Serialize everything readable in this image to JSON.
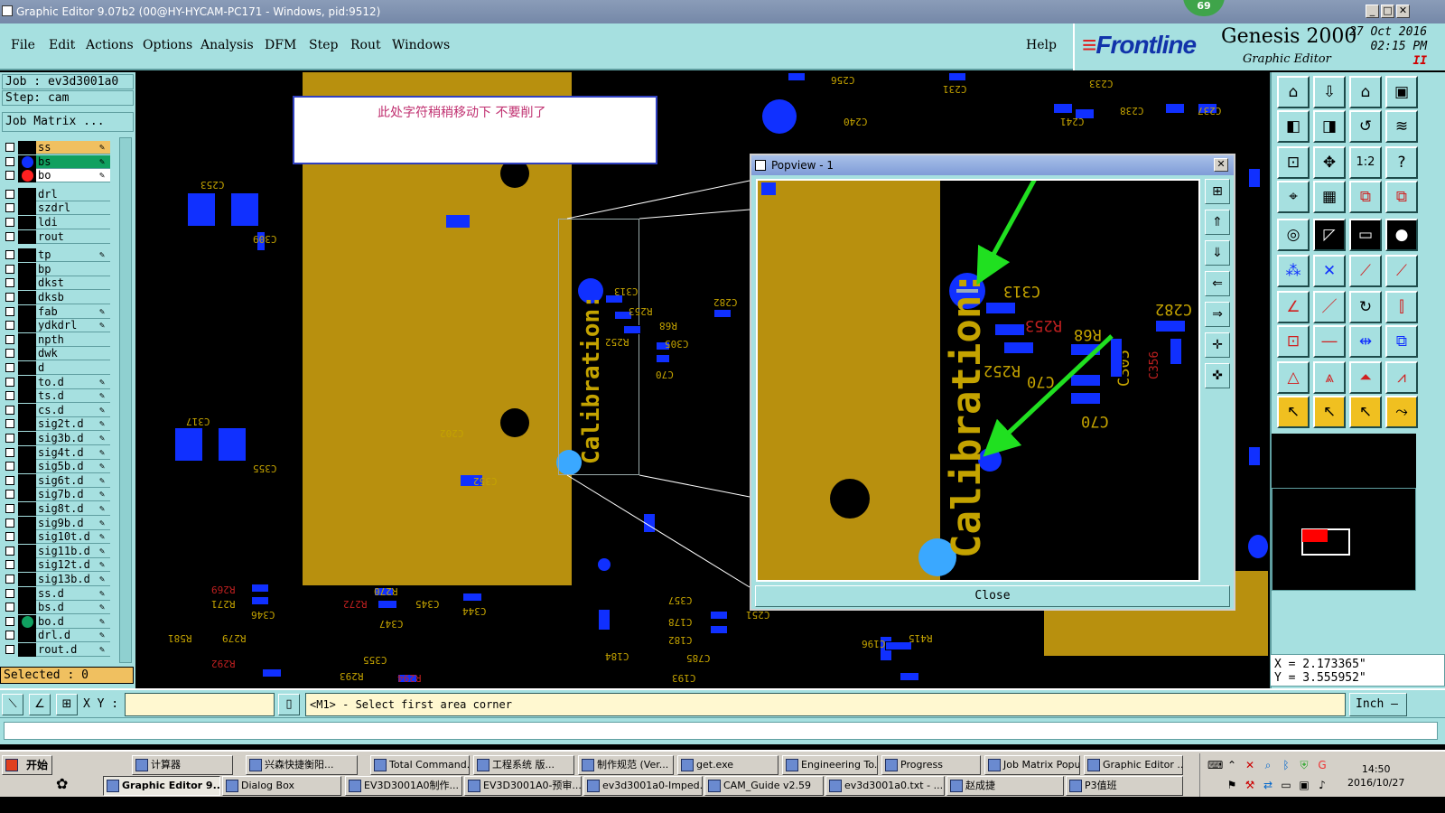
{
  "window": {
    "title": "Graphic Editor 9.07b2 (00@HY-HYCAM-PC171 - Windows, pid:9512)",
    "badge": "69"
  },
  "menu": [
    "File",
    "Edit",
    "Actions",
    "Options",
    "Analysis",
    "DFM",
    "Step",
    "Rout",
    "Windows"
  ],
  "help_label": "Help",
  "brand": {
    "logo": "Frontline",
    "product": "Genesis 2000",
    "subtitle": "Graphic Editor",
    "date": "27 Oct 2016",
    "time": "02:15 PM",
    "indicator": "II"
  },
  "left": {
    "job": "Job : ev3d3001a0",
    "step": "Step: cam",
    "job_matrix": "Job Matrix ...",
    "selected": "Selected : 0",
    "layers": [
      {
        "name": "ss",
        "color": "#f0c060",
        "dot": "",
        "mark": "✎"
      },
      {
        "name": "bs",
        "color": "#10a060",
        "dot": "#1030ff",
        "mark": "✎"
      },
      {
        "name": "bo",
        "color": "#ffffff",
        "dot": "#ff2020",
        "mark": "✎"
      },
      {
        "name": "drl",
        "color": "#a6e0e0",
        "dot": "",
        "mark": ""
      },
      {
        "name": "szdrl",
        "color": "#a6e0e0",
        "dot": "",
        "mark": ""
      },
      {
        "name": "ldi",
        "color": "#a6e0e0",
        "dot": "",
        "mark": ""
      },
      {
        "name": "rout",
        "color": "#a6e0e0",
        "dot": "",
        "mark": ""
      },
      {
        "name": "tp",
        "color": "#a6e0e0",
        "dot": "",
        "mark": "✎"
      },
      {
        "name": "bp",
        "color": "#a6e0e0",
        "dot": "",
        "mark": ""
      },
      {
        "name": "dkst",
        "color": "#a6e0e0",
        "dot": "",
        "mark": ""
      },
      {
        "name": "dksb",
        "color": "#a6e0e0",
        "dot": "",
        "mark": ""
      },
      {
        "name": "fab",
        "color": "#a6e0e0",
        "dot": "",
        "mark": "✎"
      },
      {
        "name": "ydkdrl",
        "color": "#a6e0e0",
        "dot": "",
        "mark": "✎"
      },
      {
        "name": "npth",
        "color": "#a6e0e0",
        "dot": "",
        "mark": ""
      },
      {
        "name": "dwk",
        "color": "#a6e0e0",
        "dot": "",
        "mark": ""
      },
      {
        "name": "d",
        "color": "#a6e0e0",
        "dot": "",
        "mark": ""
      },
      {
        "name": "to.d",
        "color": "#a6e0e0",
        "dot": "",
        "mark": "✎"
      },
      {
        "name": "ts.d",
        "color": "#a6e0e0",
        "dot": "",
        "mark": "✎"
      },
      {
        "name": "cs.d",
        "color": "#a6e0e0",
        "dot": "",
        "mark": "✎"
      },
      {
        "name": "sig2t.d",
        "color": "#a6e0e0",
        "dot": "",
        "mark": "✎"
      },
      {
        "name": "sig3b.d",
        "color": "#a6e0e0",
        "dot": "",
        "mark": "✎"
      },
      {
        "name": "sig4t.d",
        "color": "#a6e0e0",
        "dot": "",
        "mark": "✎"
      },
      {
        "name": "sig5b.d",
        "color": "#a6e0e0",
        "dot": "",
        "mark": "✎"
      },
      {
        "name": "sig6t.d",
        "color": "#a6e0e0",
        "dot": "",
        "mark": "✎"
      },
      {
        "name": "sig7b.d",
        "color": "#a6e0e0",
        "dot": "",
        "mark": "✎"
      },
      {
        "name": "sig8t.d",
        "color": "#a6e0e0",
        "dot": "",
        "mark": "✎"
      },
      {
        "name": "sig9b.d",
        "color": "#a6e0e0",
        "dot": "",
        "mark": "✎"
      },
      {
        "name": "sig10t.d",
        "color": "#a6e0e0",
        "dot": "",
        "mark": "✎"
      },
      {
        "name": "sig11b.d",
        "color": "#a6e0e0",
        "dot": "",
        "mark": "✎"
      },
      {
        "name": "sig12t.d",
        "color": "#a6e0e0",
        "dot": "",
        "mark": "✎"
      },
      {
        "name": "sig13b.d",
        "color": "#a6e0e0",
        "dot": "",
        "mark": "✎"
      },
      {
        "name": "ss.d",
        "color": "#a6e0e0",
        "dot": "",
        "mark": "✎"
      },
      {
        "name": "bs.d",
        "color": "#a6e0e0",
        "dot": "",
        "mark": "✎"
      },
      {
        "name": "bo.d",
        "color": "#a6e0e0",
        "dot": "#10a060",
        "mark": "✎"
      },
      {
        "name": "drl.d",
        "color": "#a6e0e0",
        "dot": "",
        "mark": "✎"
      },
      {
        "name": "rout.d",
        "color": "#a6e0e0",
        "dot": "",
        "mark": "✎"
      }
    ]
  },
  "canvas": {
    "note": "此处字符稍稍移动下  不要削了",
    "silk_labels": [
      "C253",
      "C317",
      "C309",
      "C355",
      "C313",
      "R252",
      "C70",
      "C305",
      "R253",
      "R68",
      "C282",
      "C256",
      "C240",
      "C231",
      "C238",
      "C237",
      "C233",
      "C241",
      "R269",
      "R271",
      "C346",
      "R272",
      "C347",
      "R270",
      "C345",
      "C344",
      "R279",
      "R292",
      "C355",
      "R293",
      "R294",
      "C357",
      "C178",
      "C182",
      "C193",
      "C184",
      "C785",
      "C251",
      "C196",
      "R415",
      "R581",
      "C202",
      "C352"
    ]
  },
  "popview": {
    "title": "Popview - 1",
    "close_x": "✕",
    "close_label": "Close",
    "labels": {
      "calib": "Calibration:",
      "c313": "C313",
      "r253": "R253",
      "r68": "R68",
      "r252": "R252",
      "c70": "C70",
      "c305": "C305",
      "c282": "C282"
    }
  },
  "coords": {
    "x": "X = 2.173365\"",
    "y": "Y = 3.555952\""
  },
  "cmd": {
    "xy_label": "X Y :",
    "prompt": "<M1> - Select first area corner",
    "units": "Inch —"
  },
  "taskbar": {
    "start": "开始",
    "row1": [
      "计算器",
      "兴森快捷衡阳...",
      "Total Command...",
      "工程系统  版...",
      "制作规范 (Ver...",
      "get.exe",
      "Engineering To...",
      "Progress",
      "Job Matrix Popup",
      "Graphic Editor ..."
    ],
    "row2": [
      "Graphic Editor 9....",
      "Dialog Box",
      "EV3D3001A0制作...",
      "EV3D3001A0-预审...",
      "ev3d3001a0-Imped...",
      "CAM_Guide v2.59",
      "ev3d3001a0.txt - ...",
      "赵成捷",
      "P3值班"
    ],
    "time": "14:50",
    "date": "2016/10/27"
  },
  "colors": {
    "panel": "#a6e0e0",
    "copper": "#b8900e",
    "pad": "#1030ff",
    "arrow": "#20e020",
    "silk": "#c4a300"
  }
}
